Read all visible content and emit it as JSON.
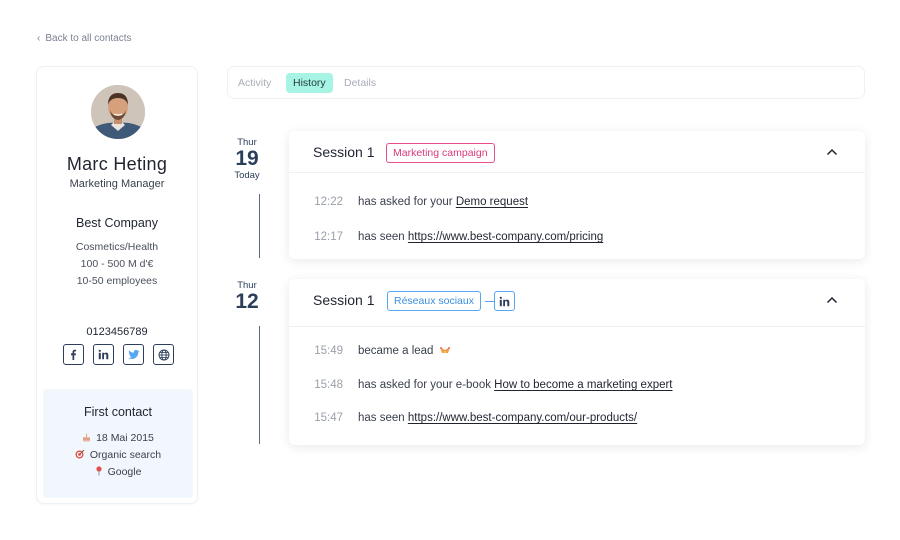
{
  "nav": {
    "back_label": "Back to all contacts"
  },
  "contact": {
    "name": "Marc Heting",
    "job_title": "Marketing Manager",
    "company": "Best Company",
    "industry": "Cosmetics/Health",
    "revenue": "100 - 500 M d'€",
    "employees": "10-50 employees",
    "phone": "0123456789",
    "socials": [
      "facebook-icon",
      "linkedin-icon",
      "twitter-icon",
      "globe-icon"
    ]
  },
  "first_contact": {
    "title": "First contact",
    "date": "18 Mai 2015",
    "source": "Organic search",
    "location": "Google"
  },
  "tabs": [
    {
      "label": "Activity",
      "active": false
    },
    {
      "label": "History",
      "active": true
    },
    {
      "label": "Details",
      "active": false
    }
  ],
  "timeline": [
    {
      "day_of_week": "Thur",
      "day": "19",
      "relative": "Today",
      "session": {
        "title": "Session 1",
        "badge": "Marketing campaign",
        "badge_color": "#ea4c8c",
        "events": [
          {
            "time": "12:22",
            "text": "has asked for your",
            "link": "Demo request"
          },
          {
            "time": "12:17",
            "text": "has seen",
            "link": "https://www.best-company.com/pricing"
          }
        ]
      }
    },
    {
      "day_of_week": "Thur",
      "day": "12",
      "relative": "",
      "session": {
        "title": "Session 1",
        "badge": "Réseaux sociaux",
        "badge_color": "#58a7f2",
        "badge_icon": "linkedin-icon",
        "events": [
          {
            "time": "15:49",
            "text": "became a lead",
            "icon": "party-icon"
          },
          {
            "time": "15:48",
            "text": "has asked for your e-book",
            "link": "How to become a marketing expert"
          },
          {
            "time": "15:47",
            "text": "has seen",
            "link": "https://www.best-company.com/our-products/"
          }
        ]
      }
    }
  ],
  "colors": {
    "accent_tab": "#a7f3e4",
    "navy": "#2b3f5a",
    "pink_badge": "#ea4c8c",
    "blue_badge": "#58a7f2",
    "first_contact_bg": "#f2f7fd"
  }
}
